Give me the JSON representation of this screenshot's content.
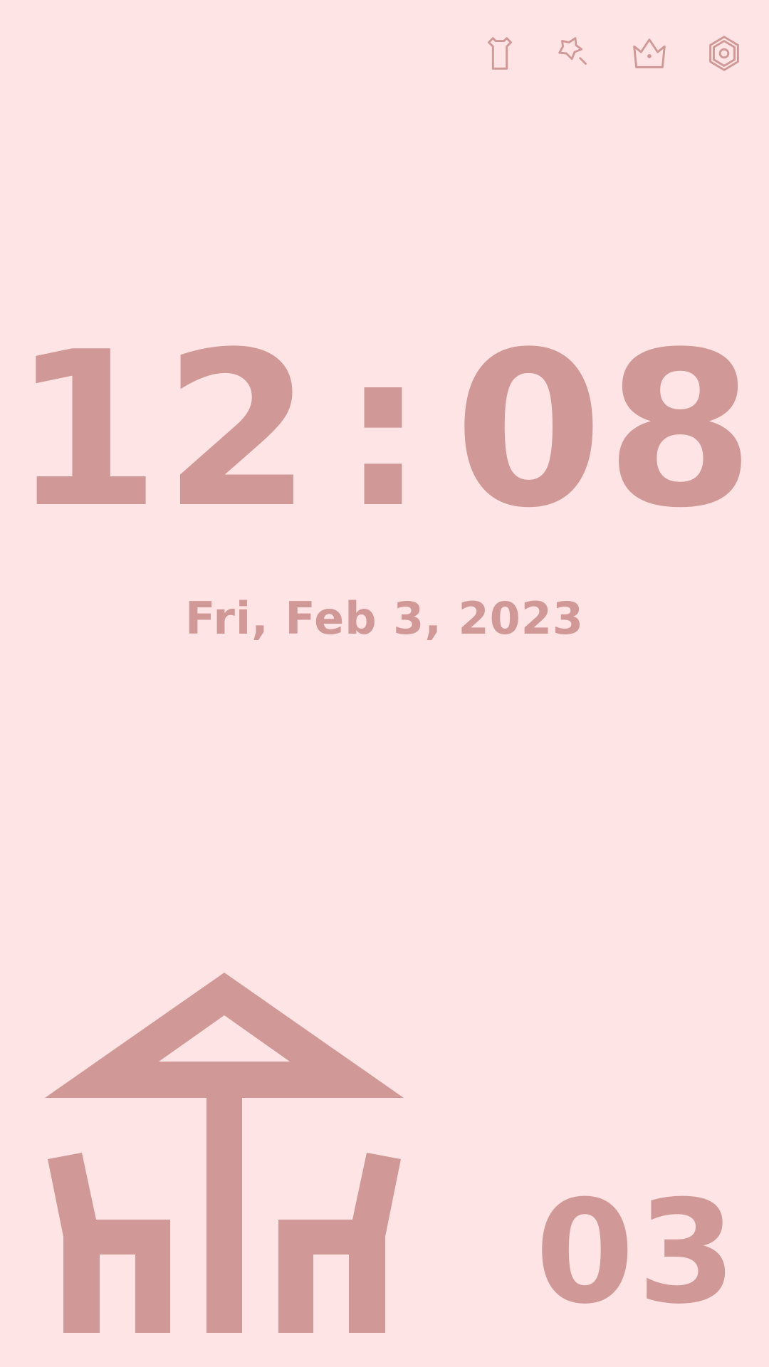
{
  "toolbar": {
    "icons": [
      "tshirt-icon",
      "sparkle-icon",
      "crown-icon",
      "settings-hexagon-icon"
    ]
  },
  "clock": {
    "hours": "12",
    "separator": ":",
    "minutes": "08",
    "seconds": "03",
    "date": "Fri, Feb 3, 2023"
  },
  "theme": {
    "background": "#FFE4E5",
    "accent": "#D09896"
  },
  "illustration": {
    "icon": "table-umbrella-chairs-icon"
  }
}
